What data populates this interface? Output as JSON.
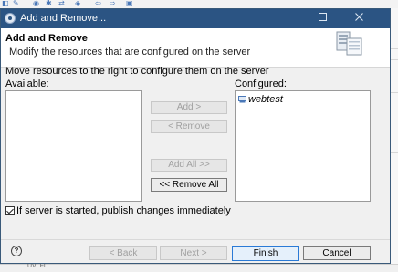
{
  "dialog": {
    "title": "Add and Remove...",
    "header_title": "Add and Remove",
    "header_description": "Modify the resources that are configured on the server",
    "instruction": "Move resources to the right to configure them on the server",
    "available_label": "Available:",
    "configured_label": "Configured:",
    "available_items": [],
    "configured_items": [
      "webtest"
    ],
    "buttons": {
      "add": "Add >",
      "remove": "< Remove",
      "add_all": "Add All >>",
      "remove_all": "<< Remove All"
    },
    "publish_checkbox": {
      "label": "If server is started, publish changes immediately",
      "checked": true
    },
    "footer": {
      "back": "< Back",
      "next": "Next >",
      "finish": "Finish",
      "cancel": "Cancel"
    }
  },
  "background": {
    "status_text": "UVLFL"
  },
  "colors": {
    "titlebar": "#2b5483",
    "primary_button_border": "#2a7ad6",
    "dialog_background": "#f0f0f0"
  }
}
